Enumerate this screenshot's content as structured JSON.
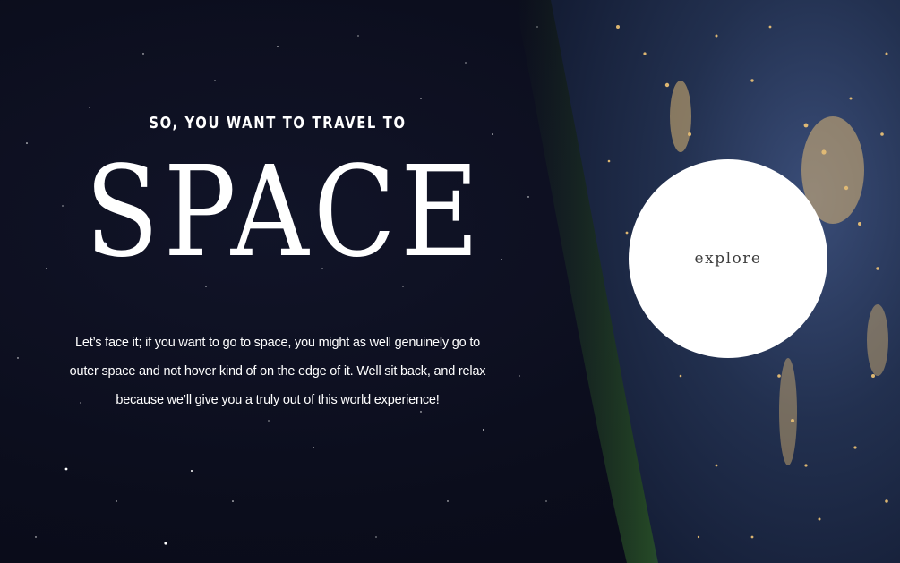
{
  "hero": {
    "kicker": "SO, YOU WANT TO TRAVEL TO",
    "headline": "SPACE",
    "body": "Let’s face it; if you want to go to space, you might as well genuinely go to outer space and not hover kind of on the edge of it. Well sit back, and relax because we’ll give you a truly out of this world experience!"
  },
  "cta": {
    "label": "explore"
  },
  "colors": {
    "background": "#0b0d1c",
    "text": "#ffffff",
    "button_bg": "#ffffff",
    "button_text": "#3d3d3d",
    "city_lights": "#f3c777",
    "atmosphere": "#3a5fa8"
  }
}
